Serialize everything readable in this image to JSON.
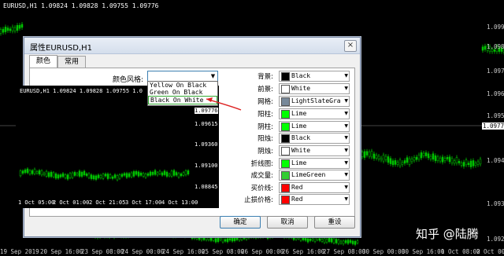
{
  "chart": {
    "title": "EURUSD,H1  1.09824 1.09828 1.09755 1.09776",
    "price_axis": [
      "1.0990",
      "1.0980",
      "1.0977",
      "1.0970",
      "1.0960",
      "1.0950",
      "1.0940",
      "1.0930",
      "1.0920"
    ],
    "time_axis": [
      "19 Sep 2019",
      "20 Sep 16:00",
      "23 Sep 08:00",
      "24 Sep 00:00",
      "24 Sep 16:00",
      "25 Sep 08:00",
      "26 Sep 00:00",
      "26 Sep 16:00",
      "27 Sep 08:00",
      "30 Sep 00:00",
      "30 Sep 16:00",
      "1 Oct 08:00",
      "2 Oct 00:00",
      "2 Oct 16:00",
      "3 Oct 08:00",
      "4 Oct 00:00",
      "4 Oct 12:00"
    ],
    "colors": {
      "background": "#000000",
      "up": "#00c000",
      "down": "#ffffff",
      "grid": "none"
    }
  },
  "dialog": {
    "title": "属性EURUSD,H1",
    "close": "×",
    "tabs": [
      "颜色",
      "常用"
    ],
    "scheme_label": "颜色风格:",
    "scheme_value": "",
    "scheme_options": [
      "Yellow On Black",
      "Green On Black",
      "Black On White"
    ],
    "preview": {
      "title": "EURUSD,H1  1.09824 1.09828 1.09755 1.0",
      "prices": [
        "1.09776",
        "1.09615",
        "1.09360",
        "1.09100",
        "1.08845"
      ],
      "times": [
        "1 Oct 05:00",
        "2 Oct 01:00",
        "2 Oct 21:05",
        "3 Oct 17:00",
        "4 Oct 13:00"
      ]
    },
    "color_rows": [
      {
        "label": "背景:",
        "name": "Black",
        "color": "#000000"
      },
      {
        "label": "前景:",
        "name": "White",
        "color": "#ffffff"
      },
      {
        "label": "网格:",
        "name": "LightSlateGray",
        "color": "#778899"
      },
      {
        "label": "阳柱:",
        "name": "Lime",
        "color": "#00ff00"
      },
      {
        "label": "阴柱:",
        "name": "Lime",
        "color": "#00ff00"
      },
      {
        "label": "阳烛:",
        "name": "Black",
        "color": "#000000"
      },
      {
        "label": "阴烛:",
        "name": "White",
        "color": "#ffffff"
      },
      {
        "label": "折线图:",
        "name": "Lime",
        "color": "#00ff00"
      },
      {
        "label": "成交量:",
        "name": "LimeGreen",
        "color": "#32cd32"
      },
      {
        "label": "买价线:",
        "name": "Red",
        "color": "#ff0000"
      },
      {
        "label": "止损价格:",
        "name": "Red",
        "color": "#ff0000"
      }
    ],
    "buttons": {
      "ok": "确定",
      "cancel": "取消",
      "reset": "重设"
    }
  },
  "watermark": "知乎 @陆腾"
}
